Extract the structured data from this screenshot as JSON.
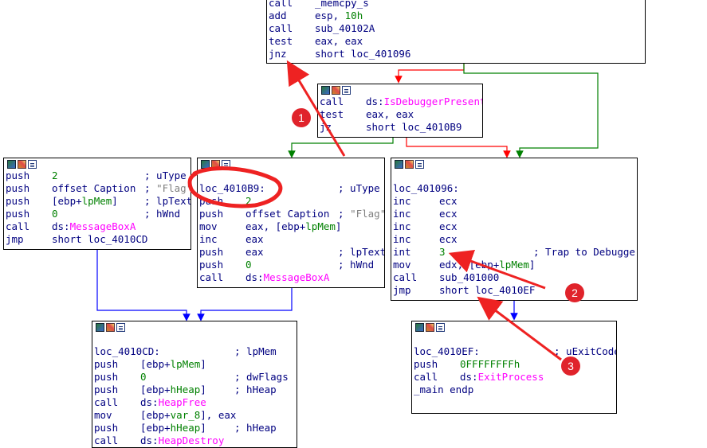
{
  "colors": {
    "background": "#ffffff",
    "text": "#000080",
    "number": "#008000",
    "import": "#ff00ff",
    "string": "#808080",
    "edge_true": "#008000",
    "edge_false": "#ff0000",
    "edge_plain": "#0000ff",
    "annotation": "#ff0000",
    "highlight_border": "#000000"
  },
  "header_icons": [
    "graph-icon",
    "edit-color-icon",
    "listing-icon"
  ],
  "nodes": [
    {
      "id": "top",
      "header": false,
      "lines": [
        {
          "m": "call",
          "o": [
            [
              "_memcpy_s",
              "sym"
            ]
          ],
          "c": []
        },
        {
          "m": "add",
          "o": [
            [
              "esp, ",
              "sym"
            ],
            [
              "10h",
              "num"
            ]
          ],
          "c": []
        },
        {
          "m": "call",
          "o": [
            [
              "sub_40102A",
              "sym"
            ]
          ],
          "c": []
        },
        {
          "m": "test",
          "o": [
            [
              "eax, eax",
              "sym"
            ]
          ],
          "c": []
        },
        {
          "m": "jnz",
          "o": [
            [
              "short loc_401096",
              "sym"
            ]
          ],
          "c": []
        }
      ]
    },
    {
      "id": "isdebugger",
      "header": true,
      "lines": [
        {
          "m": "call",
          "o": [
            [
              "ds:",
              "sym"
            ],
            [
              "IsDebuggerPresent",
              "api"
            ]
          ],
          "c": []
        },
        {
          "m": "test",
          "o": [
            [
              "eax, eax",
              "sym"
            ]
          ],
          "c": []
        },
        {
          "m": "jz",
          "o": [
            [
              "short loc_4010B9",
              "sym"
            ]
          ],
          "c": []
        }
      ]
    },
    {
      "id": "msgbox_flag",
      "header": true,
      "lines": [
        {
          "m": "push",
          "o": [
            [
              "2",
              "num"
            ]
          ],
          "c": [
            [
              "; uType",
              "cmt"
            ]
          ]
        },
        {
          "m": "push",
          "o": [
            [
              "offset Caption",
              "sym"
            ]
          ],
          "c": [
            [
              "; ",
              "cmt"
            ],
            [
              "\"Flag\"",
              "str"
            ]
          ]
        },
        {
          "m": "push",
          "o": [
            [
              "[ebp+",
              "sym"
            ],
            [
              "lpMem",
              "num"
            ],
            [
              "]",
              "sym"
            ]
          ],
          "c": [
            [
              "; lpText",
              "cmt"
            ]
          ]
        },
        {
          "m": "push",
          "o": [
            [
              "0",
              "num"
            ]
          ],
          "c": [
            [
              "; hWnd",
              "cmt"
            ]
          ]
        },
        {
          "m": "call",
          "o": [
            [
              "ds:",
              "sym"
            ],
            [
              "MessageBoxA",
              "api"
            ]
          ],
          "c": []
        },
        {
          "m": "jmp",
          "o": [
            [
              "short loc_4010CD",
              "sym"
            ]
          ],
          "c": []
        }
      ]
    },
    {
      "id": "loc_4010B9",
      "header": true,
      "lines": [
        {
          "blank": true
        },
        {
          "label": "loc_4010B9:",
          "c": [
            [
              "; uType",
              "cmt"
            ]
          ]
        },
        {
          "m": "push",
          "o": [
            [
              "2",
              "num"
            ]
          ],
          "c": []
        },
        {
          "m": "push",
          "o": [
            [
              "offset Caption",
              "sym"
            ]
          ],
          "c": [
            [
              "; ",
              "cmt"
            ],
            [
              "\"Flag\"",
              "str"
            ]
          ]
        },
        {
          "m": "mov",
          "o": [
            [
              "eax, [ebp+",
              "sym"
            ],
            [
              "lpMem",
              "num"
            ],
            [
              "]",
              "sym"
            ]
          ],
          "c": []
        },
        {
          "m": "inc",
          "o": [
            [
              "eax",
              "sym"
            ]
          ],
          "c": []
        },
        {
          "m": "push",
          "o": [
            [
              "eax",
              "sym"
            ]
          ],
          "c": [
            [
              "; lpText",
              "cmt"
            ]
          ]
        },
        {
          "m": "push",
          "o": [
            [
              "0",
              "num"
            ]
          ],
          "c": [
            [
              "; hWnd",
              "cmt"
            ]
          ]
        },
        {
          "m": "call",
          "o": [
            [
              "ds:",
              "sym"
            ],
            [
              "MessageBoxA",
              "api"
            ]
          ],
          "c": []
        }
      ]
    },
    {
      "id": "loc_401096",
      "header": true,
      "lines": [
        {
          "blank": true
        },
        {
          "label": "loc_401096:",
          "c": []
        },
        {
          "m": "inc",
          "o": [
            [
              "ecx",
              "sym"
            ]
          ],
          "c": []
        },
        {
          "m": "inc",
          "o": [
            [
              "ecx",
              "sym"
            ]
          ],
          "c": []
        },
        {
          "m": "inc",
          "o": [
            [
              "ecx",
              "sym"
            ]
          ],
          "c": []
        },
        {
          "m": "inc",
          "o": [
            [
              "ecx",
              "sym"
            ]
          ],
          "c": []
        },
        {
          "m": "int",
          "o": [
            [
              "3",
              "num"
            ]
          ],
          "c": [
            [
              "; Trap to Debugger",
              "cmt"
            ]
          ]
        },
        {
          "m": "mov",
          "o": [
            [
              "edx, [ebp+",
              "sym"
            ],
            [
              "lpMem",
              "num"
            ],
            [
              "]",
              "sym"
            ]
          ],
          "c": []
        },
        {
          "m": "call",
          "o": [
            [
              "sub_401000",
              "sym"
            ]
          ],
          "c": []
        },
        {
          "m": "jmp",
          "o": [
            [
              "short loc_4010EF",
              "sym"
            ]
          ],
          "c": []
        }
      ]
    },
    {
      "id": "loc_4010CD",
      "header": true,
      "lines": [
        {
          "blank": true
        },
        {
          "label": "loc_4010CD:",
          "c": [
            [
              "; lpMem",
              "cmt"
            ]
          ]
        },
        {
          "m": "push",
          "o": [
            [
              "[ebp+",
              "sym"
            ],
            [
              "lpMem",
              "num"
            ],
            [
              "]",
              "sym"
            ]
          ],
          "c": []
        },
        {
          "m": "push",
          "o": [
            [
              "0",
              "num"
            ]
          ],
          "c": [
            [
              "; dwFlags",
              "cmt"
            ]
          ]
        },
        {
          "m": "push",
          "o": [
            [
              "[ebp+",
              "sym"
            ],
            [
              "hHeap",
              "num"
            ],
            [
              "]",
              "sym"
            ]
          ],
          "c": [
            [
              "; hHeap",
              "cmt"
            ]
          ]
        },
        {
          "m": "call",
          "o": [
            [
              "ds:",
              "sym"
            ],
            [
              "HeapFree",
              "api"
            ]
          ],
          "c": []
        },
        {
          "m": "mov",
          "o": [
            [
              "[ebp+",
              "sym"
            ],
            [
              "var_8",
              "num"
            ],
            [
              "], eax",
              "sym"
            ]
          ],
          "c": []
        },
        {
          "m": "push",
          "o": [
            [
              "[ebp+",
              "sym"
            ],
            [
              "hHeap",
              "num"
            ],
            [
              "]",
              "sym"
            ]
          ],
          "c": [
            [
              "; hHeap",
              "cmt"
            ]
          ]
        },
        {
          "m": "call",
          "o": [
            [
              "ds:",
              "sym"
            ],
            [
              "HeapDestroy",
              "api"
            ]
          ],
          "c": []
        }
      ]
    },
    {
      "id": "loc_4010EF",
      "header": true,
      "lines": [
        {
          "blank": true
        },
        {
          "label": "loc_4010EF:",
          "c": [
            [
              "; uExitCode",
              "cmt"
            ]
          ]
        },
        {
          "m": "push",
          "o": [
            [
              "0FFFFFFFFh",
              "num"
            ]
          ],
          "c": []
        },
        {
          "m": "call",
          "o": [
            [
              "ds:",
              "sym"
            ],
            [
              "ExitProcess",
              "api"
            ]
          ],
          "c": []
        },
        {
          "label": "_main endp",
          "c": []
        }
      ]
    }
  ],
  "annotations": [
    {
      "number": "1"
    },
    {
      "number": "2"
    },
    {
      "number": "3"
    }
  ]
}
